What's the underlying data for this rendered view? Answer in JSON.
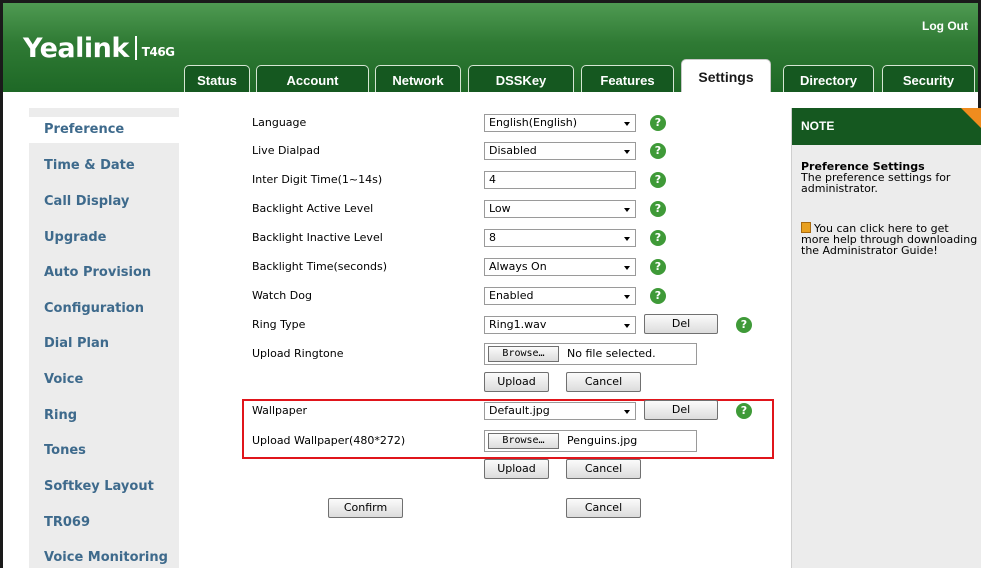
{
  "header": {
    "brand": "Yealink",
    "model": "T46G",
    "logout": "Log Out",
    "tabs": [
      {
        "label": "Status"
      },
      {
        "label": "Account"
      },
      {
        "label": "Network"
      },
      {
        "label": "DSSKey"
      },
      {
        "label": "Features"
      },
      {
        "label": "Settings",
        "active": true
      },
      {
        "label": "Directory"
      },
      {
        "label": "Security"
      }
    ]
  },
  "sidebar": {
    "items": [
      {
        "label": "Preference",
        "active": true
      },
      {
        "label": "Time & Date"
      },
      {
        "label": "Call Display"
      },
      {
        "label": "Upgrade"
      },
      {
        "label": "Auto Provision"
      },
      {
        "label": "Configuration"
      },
      {
        "label": "Dial Plan"
      },
      {
        "label": "Voice"
      },
      {
        "label": "Ring"
      },
      {
        "label": "Tones"
      },
      {
        "label": "Softkey Layout"
      },
      {
        "label": "TR069"
      },
      {
        "label": "Voice Monitoring"
      }
    ]
  },
  "form": {
    "language": {
      "label": "Language",
      "value": "English(English)"
    },
    "live_dialpad": {
      "label": "Live Dialpad",
      "value": "Disabled"
    },
    "inter_digit": {
      "label": "Inter Digit Time(1~14s)",
      "value": "4"
    },
    "backlight_active": {
      "label": "Backlight Active Level",
      "value": "Low"
    },
    "backlight_inactive": {
      "label": "Backlight Inactive Level",
      "value": "8"
    },
    "backlight_time": {
      "label": "Backlight Time(seconds)",
      "value": "Always On"
    },
    "watch_dog": {
      "label": "Watch Dog",
      "value": "Enabled"
    },
    "ring_type": {
      "label": "Ring Type",
      "value": "Ring1.wav",
      "del": "Del"
    },
    "upload_ringtone": {
      "label": "Upload Ringtone",
      "browse": "Browse…",
      "file": "No file selected.",
      "upload": "Upload",
      "cancel": "Cancel"
    },
    "wallpaper": {
      "label": "Wallpaper",
      "value": "Default.jpg",
      "del": "Del"
    },
    "upload_wallpaper": {
      "label": "Upload Wallpaper(480*272)",
      "browse": "Browse…",
      "file": "Penguins.jpg",
      "upload": "Upload",
      "cancel": "Cancel"
    },
    "confirm": "Confirm",
    "cancel": "Cancel",
    "help_glyph": "?"
  },
  "note": {
    "heading": "NOTE",
    "title": "Preference Settings",
    "text": "The preference settings for administrator.",
    "help": "You can click here to get more help through downloading the Administrator Guide!"
  },
  "colors": {
    "header_green": "#2f7a34",
    "tab_dark": "#155820",
    "sidebar_link": "#3e6a8c",
    "help_green": "#3f9a38",
    "highlight_red": "#e0151b",
    "note_accent": "#f08c1e"
  }
}
